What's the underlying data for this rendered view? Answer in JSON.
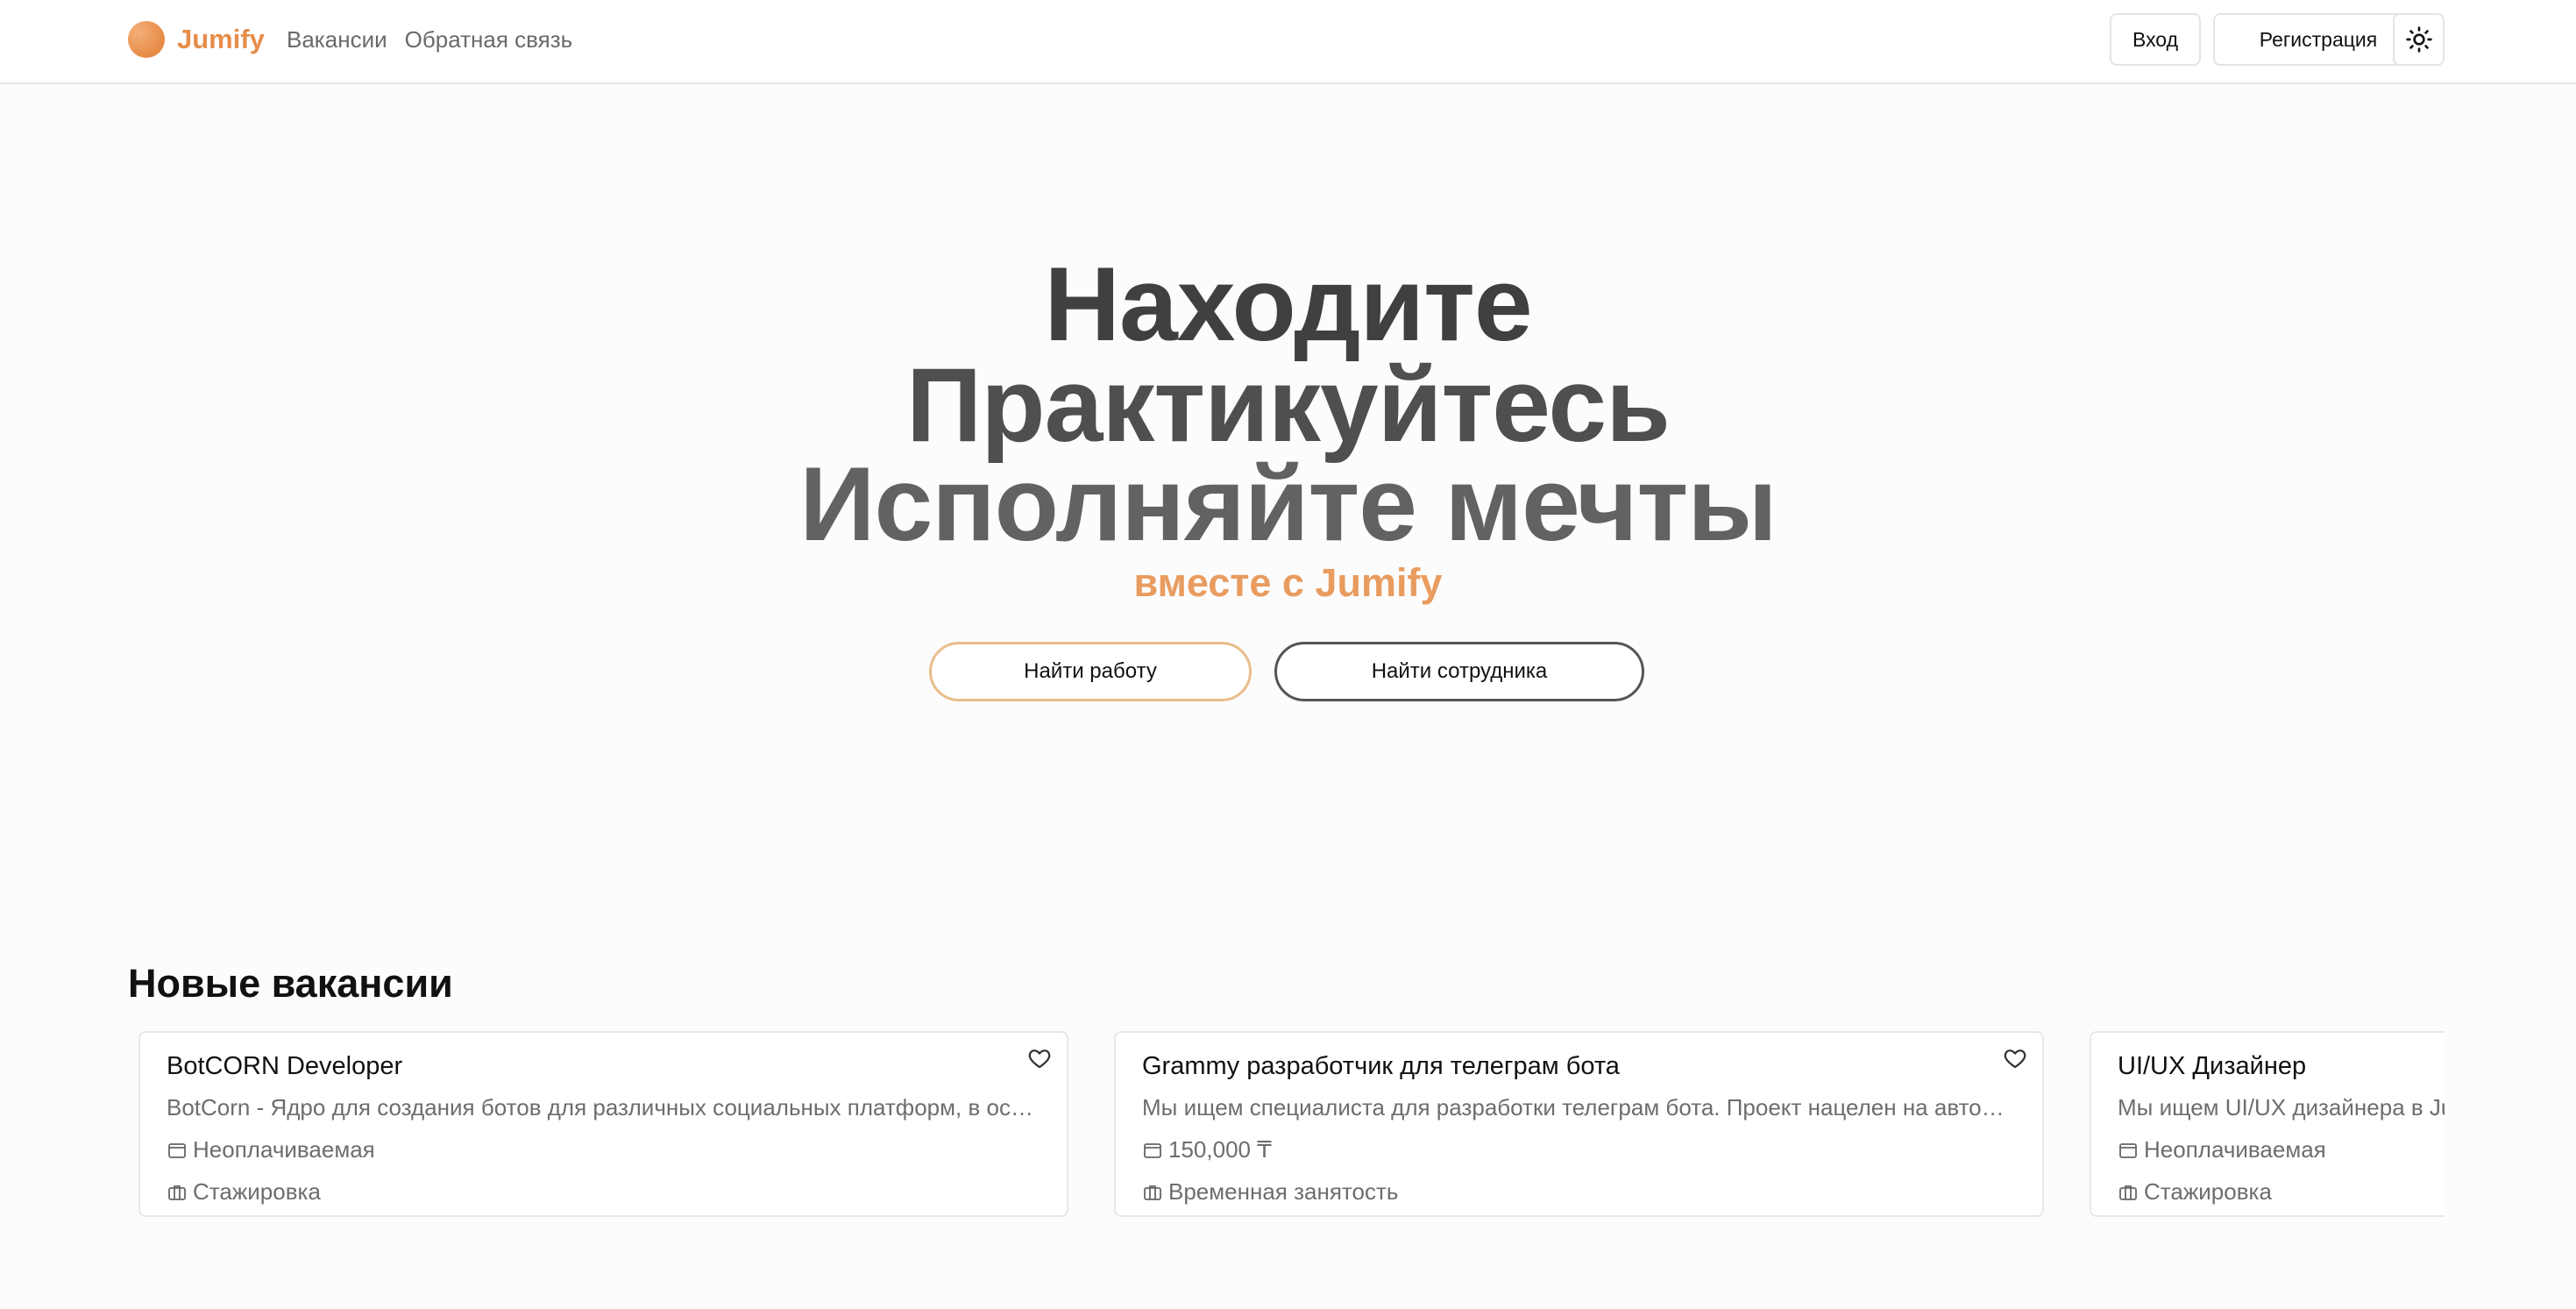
{
  "header": {
    "brand": "Jumify",
    "nav": [
      "Вакансии",
      "Обратная связь"
    ],
    "login_label": "Вход",
    "register_label": "Регистрация"
  },
  "hero": {
    "line1": "Находите",
    "line2": "Практикуйтесь",
    "line3": "Исполняйте мечты",
    "subtitle": "вместе с Jumify",
    "find_job_label": "Найти работу",
    "find_employee_label": "Найти сотрудника"
  },
  "vacancies": {
    "title": "Новые вакансии",
    "items": [
      {
        "title": "BotCORN Developer",
        "description": "BotCorn - Ядро для создания ботов для различных социальных платформ, в основе",
        "salary": "Неоплачиваемая",
        "type": "Стажировка"
      },
      {
        "title": "Grammy разработчик для телеграм бота",
        "description": "Мы ищем специалиста для разработки телеграм бота. Проект нацелен на автоматизацию",
        "salary": "150,000 ₸",
        "type": "Временная занятость"
      },
      {
        "title": "UI/UX Дизайнер",
        "description": "Мы ищем UI/UX дизайнера в Jumify",
        "salary": "Неоплачиваемая",
        "type": "Стажировка"
      }
    ]
  },
  "colors": {
    "accent": "#e68d4a",
    "hero_text": "#404040",
    "muted_text": "#6d6d6d"
  },
  "icons": [
    "sun-icon",
    "heart-icon",
    "wallet-icon",
    "briefcase-icon"
  ]
}
